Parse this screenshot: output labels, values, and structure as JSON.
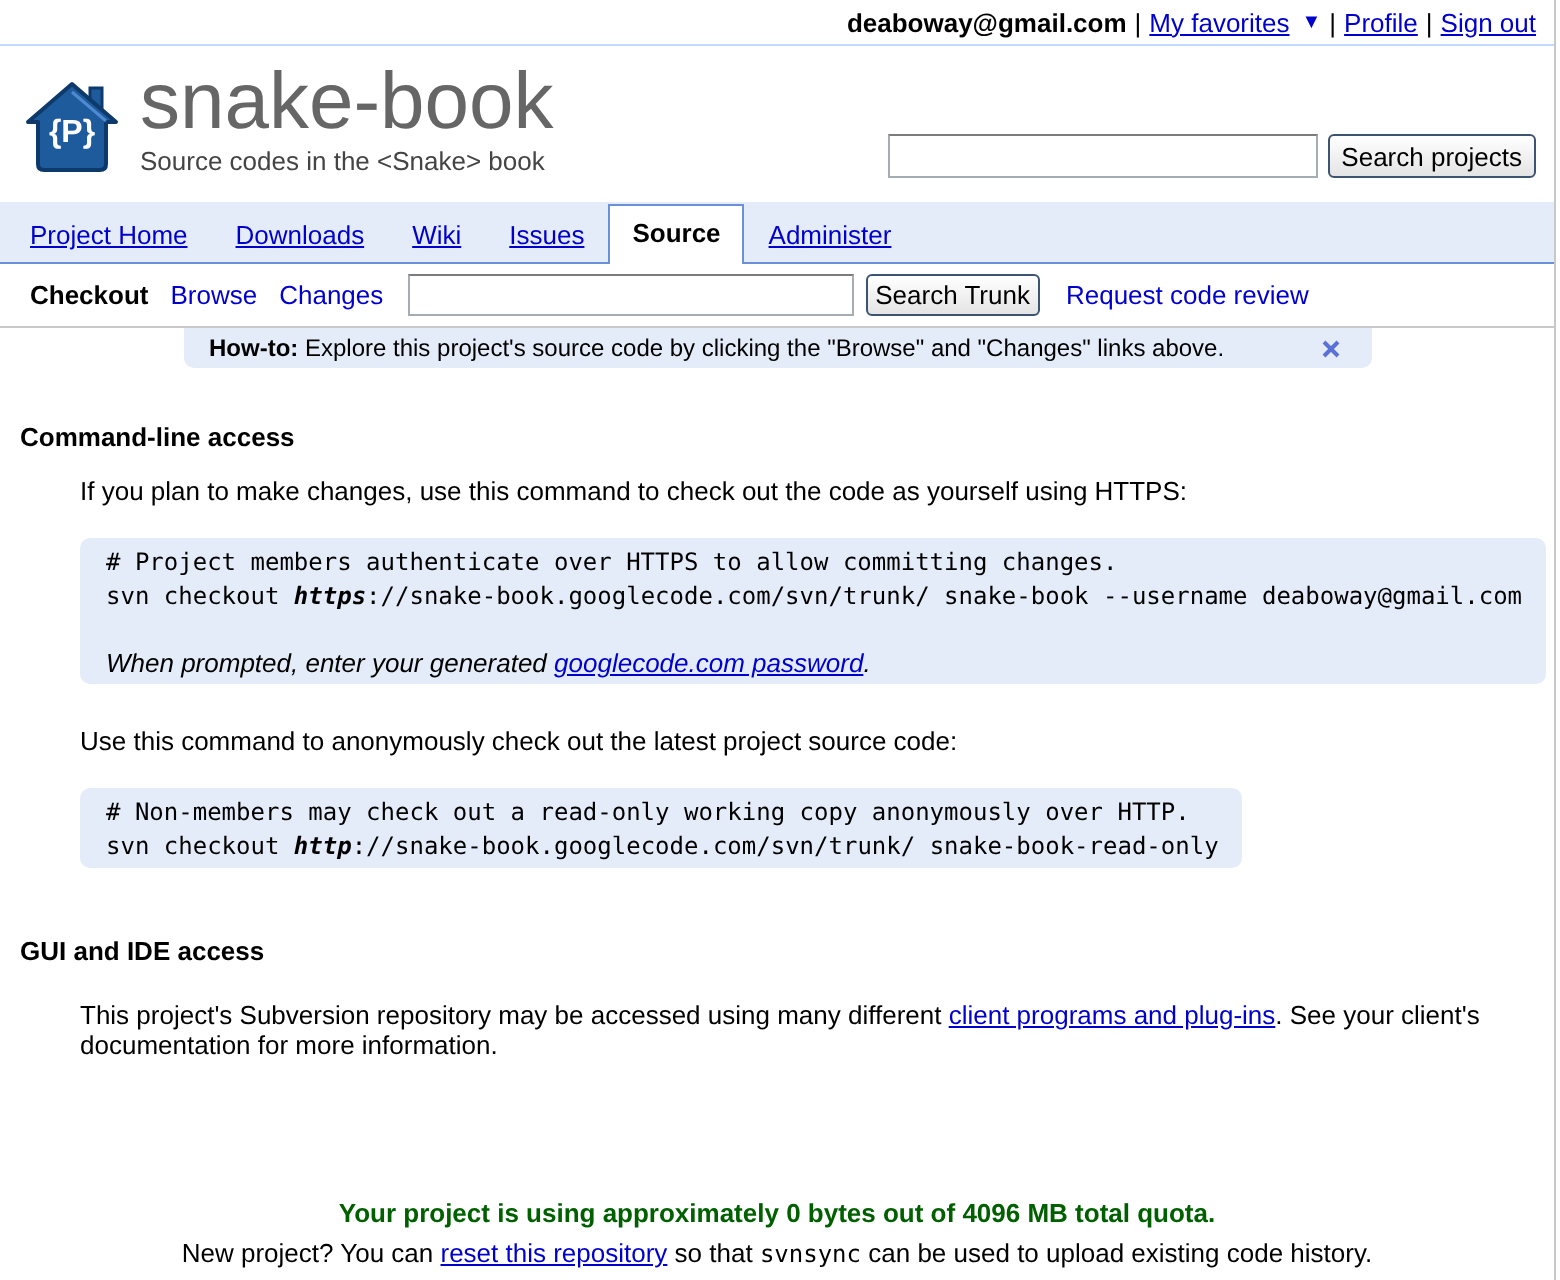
{
  "user_bar": [
    {
      "kind": "email",
      "text": "deaboway@gmail.com"
    },
    {
      "kind": "separator",
      "text": "|"
    },
    {
      "kind": "link",
      "text": "My favorites"
    },
    {
      "kind": "caret",
      "text": "▼"
    },
    {
      "kind": "separator",
      "text": "|"
    },
    {
      "kind": "link",
      "text": "Profile"
    },
    {
      "kind": "separator",
      "text": "|"
    },
    {
      "kind": "link",
      "text": "Sign out"
    }
  ],
  "header": {
    "logo_text": "{P}",
    "title": "snake-book",
    "summary": "Source codes in the <Snake> book",
    "search": {
      "button": "Search projects"
    }
  },
  "tabs": [
    {
      "label": "Project Home",
      "selected": false
    },
    {
      "label": "Downloads",
      "selected": false
    },
    {
      "label": "Wiki",
      "selected": false
    },
    {
      "label": "Issues",
      "selected": false
    },
    {
      "label": "Source",
      "selected": true
    },
    {
      "label": "Administer",
      "selected": false
    }
  ],
  "subnav": {
    "items": [
      {
        "label": "Checkout",
        "selected": true
      },
      {
        "label": "Browse",
        "selected": false
      },
      {
        "label": "Changes",
        "selected": false
      }
    ],
    "search": {
      "button": "Search Trunk"
    },
    "review_link": "Request code review"
  },
  "howto": {
    "text": "**How-to:** Explore this project's source code by clicking the \"Browse\" and \"Changes\" links above."
  },
  "sections": [
    {
      "heading": "Command-line access",
      "blocks": [
        {
          "kind": "paragraph",
          "text": "If you plan to make changes, use this command to check out the code as yourself using HTTPS:"
        },
        {
          "kind": "code",
          "lines": [
            "# Project members authenticate over HTTPS to allow committing changes.",
            "svn checkout **https**://snake-book.googlecode.com/svn/trunk/ snake-book --username deaboway@gmail.com"
          ],
          "note": {
            "before": "When prompted, enter your generated ",
            "link": "googlecode.com password",
            "after": "."
          }
        },
        {
          "kind": "paragraph",
          "text": "Use this command to anonymously check out the latest project source code:"
        },
        {
          "kind": "code",
          "lines": [
            "# Non-members may check out a read-only working copy anonymously over HTTP.",
            "svn checkout **http**://snake-book.googlecode.com/svn/trunk/ snake-book-read-only"
          ]
        }
      ]
    },
    {
      "heading": "GUI and IDE access",
      "blocks": [
        {
          "kind": "paragraph",
          "before": "This project's Subversion repository may be accessed using many different ",
          "link": "client programs and plug-ins",
          "after": ". See your client's documentation for more information."
        }
      ]
    }
  ],
  "footer": {
    "quota": "Your project is using approximately 0 bytes out of 4096 MB total quota.",
    "reset": {
      "before": "New project? You can ",
      "link": "reset this repository",
      "middle": " so that ",
      "code": "svnsync",
      "after": " can be used to upload existing code history."
    }
  }
}
